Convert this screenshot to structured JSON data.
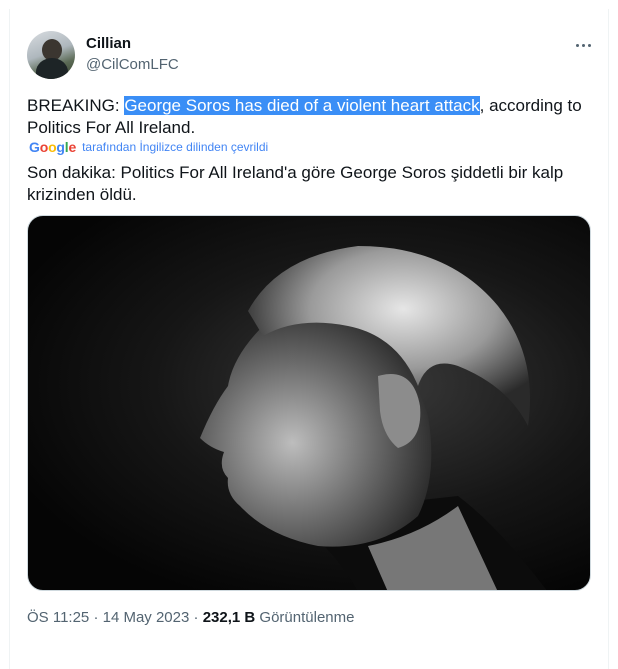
{
  "author": {
    "name": "Cillian",
    "handle": "@CilComLFC"
  },
  "tweet": {
    "prefix": "BREAKING: ",
    "highlighted": "George Soros has died of a violent heart attack",
    "suffix": ", according to Politics For All Ireland."
  },
  "translation": {
    "brand": "Google",
    "note": "tarafından İngilizce dilinden çevrildi",
    "text": "Son dakika: Politics For All Ireland'a göre George Soros şiddetli bir kalp krizinden öldü."
  },
  "media": {
    "description_icon": "photo"
  },
  "meta": {
    "time": "ÖS 11:25",
    "separator": "·",
    "date": "14 May 2023",
    "views_count": "232,1 B",
    "views_label": "Görüntülenme"
  },
  "colors": {
    "highlight": "#3a8ef6",
    "secondary_text": "#536471",
    "google_blue": "#4285f4"
  }
}
